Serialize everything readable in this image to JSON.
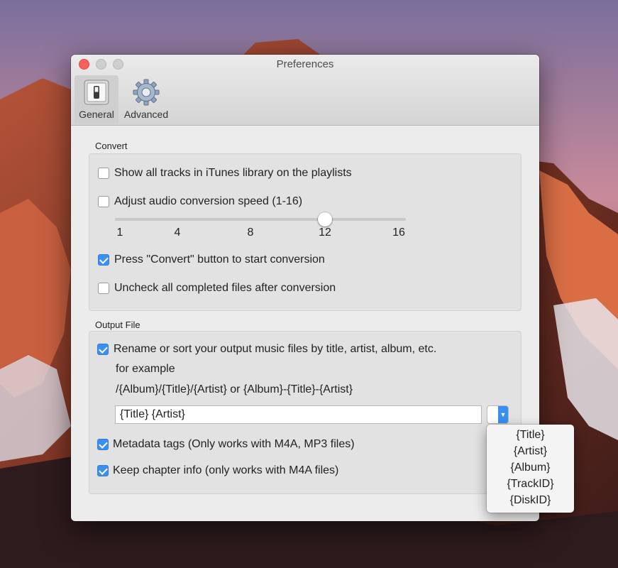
{
  "window": {
    "title": "Preferences"
  },
  "toolbar": {
    "general": {
      "label": "General",
      "icon": "toggle-switch-icon",
      "selected": true
    },
    "advanced": {
      "label": "Advanced",
      "icon": "gear-icon"
    }
  },
  "convert": {
    "section_label": "Convert",
    "show_tracks": {
      "label": "Show all tracks in iTunes library on the playlists",
      "checked": false
    },
    "adjust_speed": {
      "label": "Adjust audio conversion speed (1-16)",
      "checked": false
    },
    "speed_slider": {
      "ticks": [
        "1",
        "4",
        "8",
        "12",
        "16"
      ],
      "value": 12,
      "min": 1,
      "max": 16
    },
    "press_convert": {
      "label": "Press \"Convert\" button to start conversion",
      "checked": true
    },
    "uncheck_completed": {
      "label": "Uncheck all completed files after conversion",
      "checked": false
    }
  },
  "output": {
    "section_label": "Output File",
    "rename": {
      "label": "Rename or sort your output music files by title, artist, album, etc.",
      "checked": true
    },
    "example_label": "for example",
    "example_pattern": "/{Album}/{Title}/{Artist} or {Album}-{Title}-{Artist}",
    "pattern_value": "{Title} {Artist}",
    "metadata": {
      "label": "Metadata tags (Only works with M4A, MP3 files)",
      "checked": true
    },
    "chapters": {
      "label": "Keep chapter info (only works with  M4A files)",
      "checked": true
    }
  },
  "tag_menu": {
    "items": [
      "{Title}",
      "{Artist}",
      "{Album}",
      "{TrackID}",
      "{DiskID}"
    ]
  },
  "colors": {
    "accent": "#3b8ff0",
    "close": "#fc605c"
  }
}
